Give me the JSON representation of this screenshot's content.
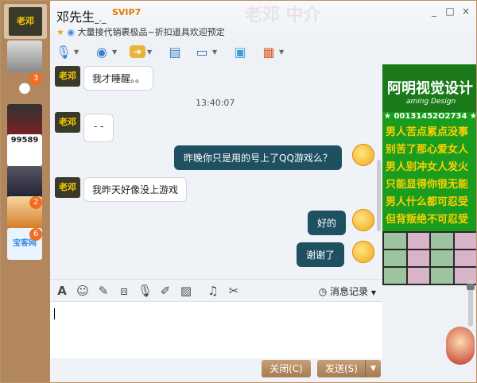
{
  "header": {
    "name": "邓先生",
    "name_suffix": "_._",
    "vip": "SVIP7",
    "status": "大量接代销裹极品~折扣道具欢迎预定",
    "watermark": "老邓 中介"
  },
  "window_controls": [
    "_",
    "□",
    "×"
  ],
  "toolbar": {
    "items": [
      {
        "name": "voice-call",
        "icon": "microphone"
      },
      {
        "name": "video-call",
        "icon": "webcam"
      },
      {
        "name": "send-file",
        "icon": "folder-arrow"
      },
      {
        "name": "new-discussion",
        "icon": "chat-plus"
      },
      {
        "name": "remote-desktop",
        "icon": "monitor"
      },
      {
        "name": "share-screen",
        "icon": "screen-share"
      },
      {
        "name": "apps",
        "icon": "apps-grid"
      }
    ]
  },
  "contacts": [
    {
      "label": "老邓",
      "badge": ""
    },
    {
      "label": "",
      "badge": ""
    },
    {
      "label": "",
      "badge": "3"
    },
    {
      "label": "",
      "badge": ""
    },
    {
      "label": "99589",
      "badge": ""
    },
    {
      "label": "",
      "badge": ""
    },
    {
      "label": "",
      "badge": "2"
    },
    {
      "label": "宝客网",
      "badge": "6"
    }
  ],
  "messages": [
    {
      "side": "left",
      "text": "我才睡醒。。"
    },
    {
      "side": "time",
      "text": "13:40:07"
    },
    {
      "side": "left",
      "text": "- -"
    },
    {
      "side": "right",
      "text": "昨晚你只是用的号上了QQ游戏么？"
    },
    {
      "side": "left",
      "text": "我昨天好像没上游戏"
    },
    {
      "side": "right",
      "text": "好的"
    },
    {
      "side": "right",
      "text": "谢谢了"
    }
  ],
  "avatar_text": "老邓",
  "input_tools": {
    "history_label": "消息记录"
  },
  "footer": {
    "close_label": "关闭(C)",
    "send_label": "发送(S)"
  },
  "ad": {
    "banner": "阿明视觉设计",
    "subtitle": "aming Design",
    "number": "★ 00131452O2734 ★",
    "lines": [
      "男人苦点累点没事",
      "别苦了那心爱女人",
      "男人别冲女人发火",
      "只能显得你很无能",
      "男人什么都可忍受",
      "但背叛绝不可忍受"
    ]
  },
  "colors": {
    "strip": "#b2875e",
    "outgoing": "#1f5062",
    "button": "#b08457",
    "ad_green": "#1a9d1e"
  }
}
